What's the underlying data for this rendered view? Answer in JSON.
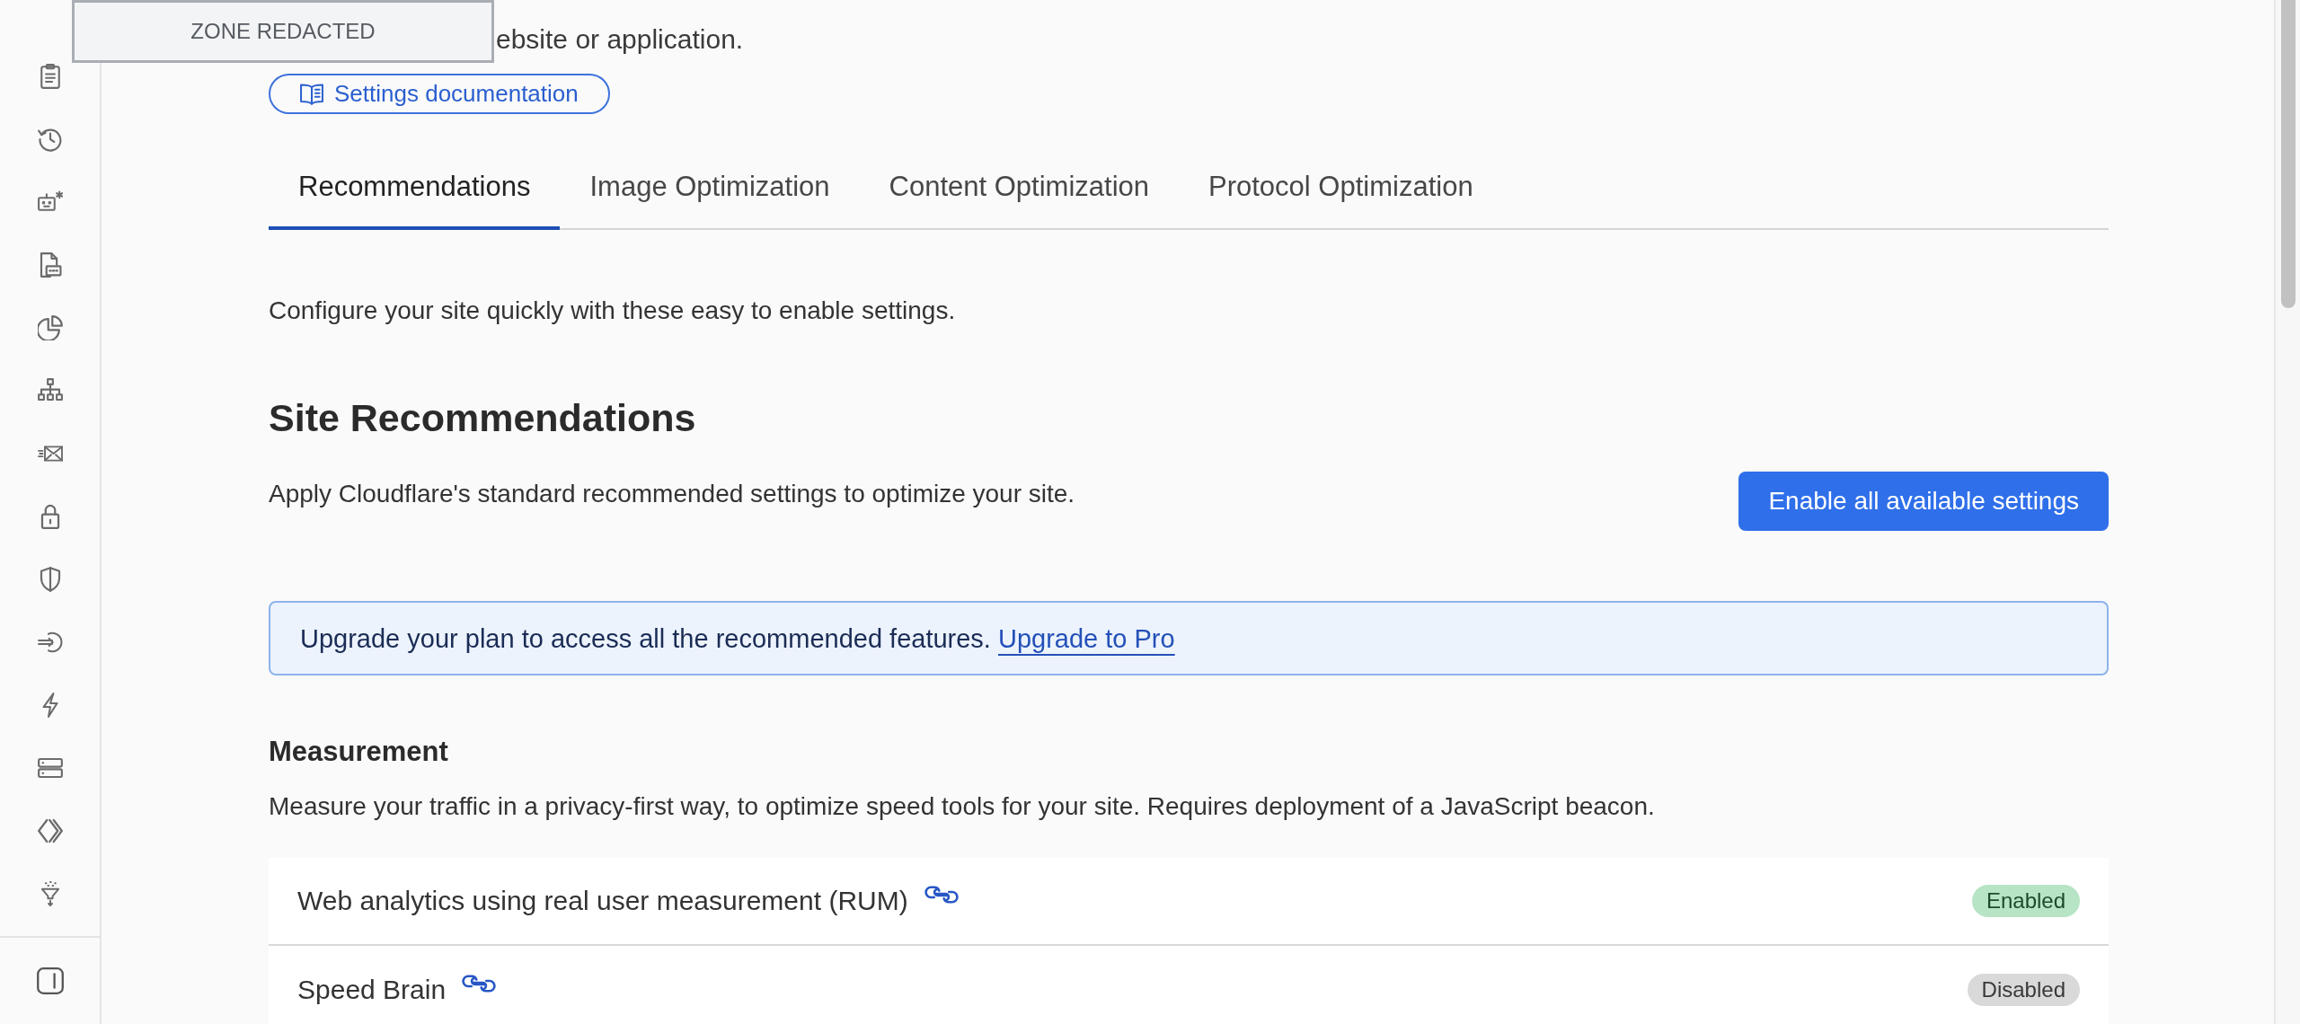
{
  "redaction": {
    "label": "ZONE REDACTED"
  },
  "header": {
    "description": "ebsite or application.",
    "docs_button": "Settings documentation"
  },
  "tabs": [
    {
      "label": "Recommendations",
      "selected": true
    },
    {
      "label": "Image Optimization",
      "selected": false
    },
    {
      "label": "Content Optimization",
      "selected": false
    },
    {
      "label": "Protocol Optimization",
      "selected": false
    }
  ],
  "intro": "Configure your site quickly with these easy to enable settings.",
  "site_recommendations": {
    "title": "Site Recommendations",
    "description": "Apply Cloudflare's standard recommended settings to optimize your site.",
    "button": "Enable all available settings"
  },
  "banner": {
    "text": "Upgrade your plan to access all the recommended features.",
    "link": "Upgrade to Pro"
  },
  "sections": [
    {
      "title": "Measurement",
      "description": "Measure your traffic in a privacy-first way, to optimize speed tools for your site. Requires deployment of a JavaScript beacon.",
      "rows": [
        {
          "label": "Web analytics using real user measurement (RUM)",
          "status": "Enabled",
          "enabled": true
        },
        {
          "label": "Speed Brain",
          "status": "Disabled",
          "enabled": false
        }
      ]
    }
  ]
}
